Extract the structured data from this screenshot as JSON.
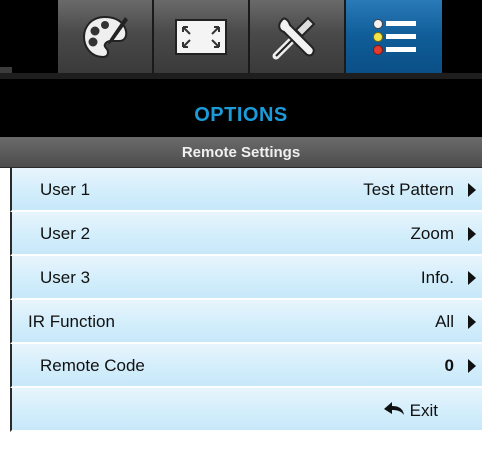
{
  "tabs": [
    {
      "icon": "image-palette-icon",
      "active": false
    },
    {
      "icon": "display-screen-icon",
      "active": false
    },
    {
      "icon": "setup-tools-icon",
      "active": false
    },
    {
      "icon": "options-list-icon",
      "active": true
    }
  ],
  "menu_title": "OPTIONS",
  "submenu_title": "Remote Settings",
  "rows": [
    {
      "label": "User 1",
      "value": "Test Pattern"
    },
    {
      "label": "User 2",
      "value": "Zoom"
    },
    {
      "label": "User 3",
      "value": "Info."
    },
    {
      "label": "IR Function",
      "value": "All"
    },
    {
      "label": "Remote Code",
      "value": "0"
    }
  ],
  "exit_label": "Exit",
  "colors": {
    "accent": "#1b9bd8",
    "row_bg": "#d3eefb",
    "active_tab": "#0f5d98"
  }
}
